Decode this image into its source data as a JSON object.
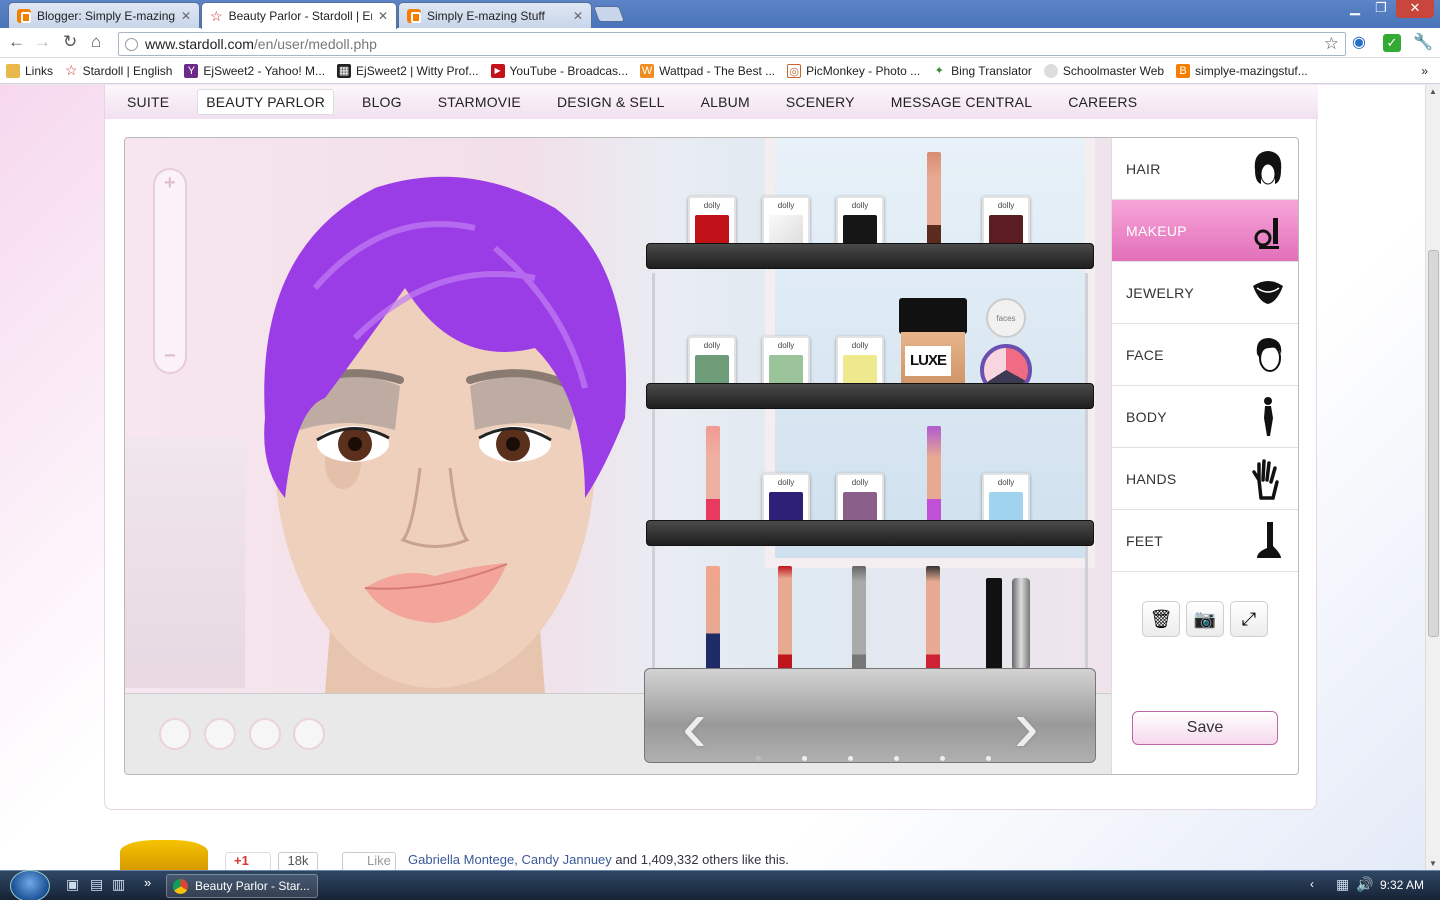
{
  "browser": {
    "tabs": [
      {
        "title": "Blogger: Simply E-mazing S",
        "icon": "blogger-icon",
        "active": false
      },
      {
        "title": "Beauty Parlor - Stardoll | En",
        "icon": "stardoll-star-icon",
        "active": true
      },
      {
        "title": "Simply E-mazing Stuff",
        "icon": "blogger-icon",
        "active": false
      }
    ],
    "url_domain": "www.stardoll.com",
    "url_path": "/en/user/medoll.php",
    "bookmarks": [
      {
        "label": "Links",
        "icon": "folder-icon"
      },
      {
        "label": "Stardoll | English",
        "icon": "stardoll-star-icon"
      },
      {
        "label": "EjSweet2 - Yahoo! M...",
        "icon": "yahoo-icon"
      },
      {
        "label": "EjSweet2 | Witty Prof...",
        "icon": "film-icon"
      },
      {
        "label": "YouTube - Broadcas...",
        "icon": "youtube-icon"
      },
      {
        "label": "Wattpad - The Best ...",
        "icon": "wattpad-icon"
      },
      {
        "label": "PicMonkey - Photo ...",
        "icon": "picmonkey-icon"
      },
      {
        "label": "Bing Translator",
        "icon": "translator-icon"
      },
      {
        "label": "Schoolmaster Web",
        "icon": "globe-icon"
      },
      {
        "label": "simplye-mazingstuf...",
        "icon": "blogger-icon"
      }
    ]
  },
  "site_nav": {
    "items": [
      "SUITE",
      "BEAUTY PARLOR",
      "BLOG",
      "STARMOVIE",
      "DESIGN & SELL",
      "ALBUM",
      "SCENERY",
      "MESSAGE CENTRAL",
      "CAREERS"
    ],
    "active": "BEAUTY PARLOR"
  },
  "slider": {
    "plus": "+",
    "minus": "−"
  },
  "shelf_products": {
    "row1": [
      "red-shadow",
      "white-shadow",
      "black-shadow",
      "brown-pencil",
      "maroon-shadow"
    ],
    "row2": [
      "green-shadow",
      "mint-shadow",
      "yellow-shadow",
      "luxe-foundation",
      "faces-blush"
    ],
    "row3": [
      "pink-pencil",
      "indigo-shadow",
      "mauve-shadow",
      "purple-pencil",
      "blue-shadow"
    ],
    "row4": [
      "navy-pencil",
      "red-pencil",
      "grey-pencil",
      "pink-pencil-2",
      "luxe-mascara",
      "glitter-gloss"
    ]
  },
  "pot_label": "dolly",
  "foundation_label": "LUXE",
  "blush_label": "faces",
  "categories": [
    {
      "label": "HAIR",
      "icon": "hair-icon",
      "active": false
    },
    {
      "label": "MAKEUP",
      "icon": "makeup-icon",
      "active": true
    },
    {
      "label": "JEWELRY",
      "icon": "jewelry-icon",
      "active": false
    },
    {
      "label": "FACE",
      "icon": "face-icon",
      "active": false
    },
    {
      "label": "BODY",
      "icon": "body-icon",
      "active": false
    },
    {
      "label": "HANDS",
      "icon": "hand-icon",
      "active": false
    },
    {
      "label": "FEET",
      "icon": "foot-icon",
      "active": false
    }
  ],
  "save_label": "Save",
  "page_footer": {
    "plusone": "+1",
    "plusone_count": "18k",
    "like": "Like",
    "likes_text_links": "Gabriella Montege, Candy Jannuey",
    "likes_text_rest": " and 1,409,332 others like this."
  },
  "taskbar": {
    "window_title": "Beauty Parlor - Star...",
    "clock": "9:32 AM"
  },
  "colors": {
    "accent_pink": "#e26fb9",
    "hair_purple": "#9b3de6",
    "taskbar": "#172335"
  }
}
